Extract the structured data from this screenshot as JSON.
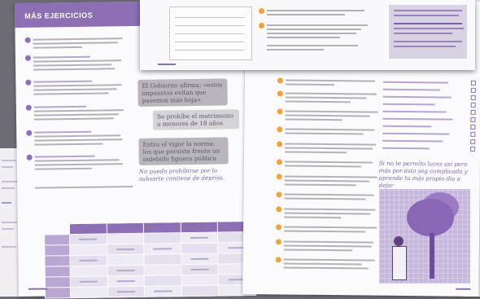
{
  "left_page": {
    "section_title": "MÁS EJERCICIOS",
    "callouts": [
      "El Gobierno afirma: «estos impuestos evitan que pasemos más hoja».",
      "Se prohíbe el matrimonio a menores de 18 años",
      "Entra el vigor la norma: los que persiste frente un indebido figuera pública"
    ],
    "handwritten_note": "No puedo prohibirse por lo subsorte contiene de deprisa."
  },
  "right_page": {
    "handwritten_note": "Si no te permito luces así pero más por ésta seg complicada y aprende tu más propio dia a dejar"
  }
}
